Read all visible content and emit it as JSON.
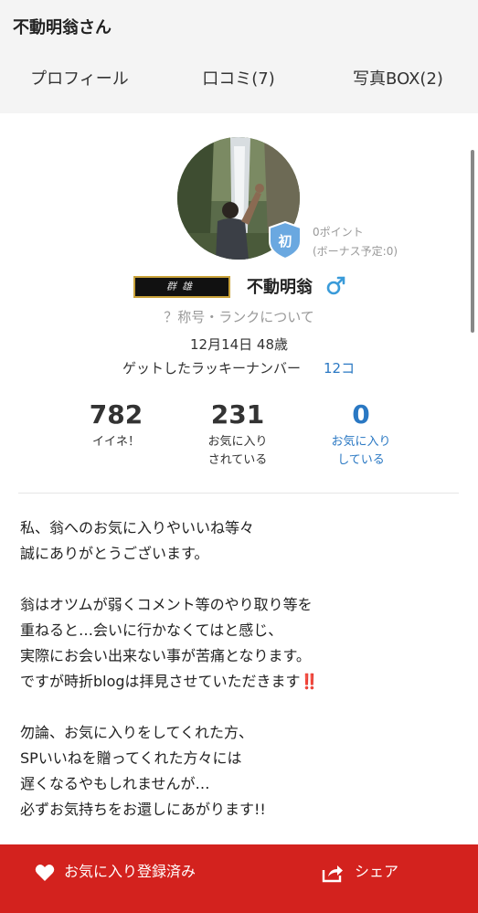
{
  "header": {
    "title": "不動明翁さん"
  },
  "tabs": [
    {
      "label": "プロフィール",
      "active": true
    },
    {
      "label": "口コミ(7)"
    },
    {
      "label": "写真BOX(2)"
    }
  ],
  "profile": {
    "badge_text": "初",
    "points": "0ポイント",
    "bonus": "(ボーナス予定:0)",
    "rank_title": "群雄",
    "username": "不動明翁",
    "gender_icon": "male-symbol-icon",
    "title_link": "？称号・ランクについて",
    "birth_age": "12月14日 48歳",
    "lucky_label": "ゲットしたラッキーナンバー",
    "lucky_value": "12コ"
  },
  "stats": [
    {
      "value": "782",
      "label_lines": [
        "イイネ！"
      ]
    },
    {
      "value": "231",
      "label_lines": [
        "お気に入り",
        "されている"
      ]
    },
    {
      "value": "0",
      "label_lines": [
        "お気に入り",
        "している"
      ]
    }
  ],
  "bio": {
    "lines": [
      "私、翁へのお気に入りやいいね等々",
      "誠にありがとうございます。",
      "",
      "翁はオツムが弱くコメント等のやり取り等を",
      "重ねると…会いに行かなくてはと感じ、",
      "実際にお会い出来ない事が苦痛となります。",
      "ですが時折blogは拝見させていただきます",
      "",
      "勿論、お気に入りをしてくれた方、",
      "SPいいねを贈ってくれた方々には",
      "遅くなるやもしれませんが…",
      "必ずお気持ちをお還しにあがります!!"
    ],
    "emphasis": "‼️"
  },
  "bottom_bar": {
    "favorite_label": "お気に入り登録済み",
    "share_label": "シェア"
  },
  "colors": {
    "accent_red": "#d3221e",
    "link_blue": "#2a78c3"
  }
}
